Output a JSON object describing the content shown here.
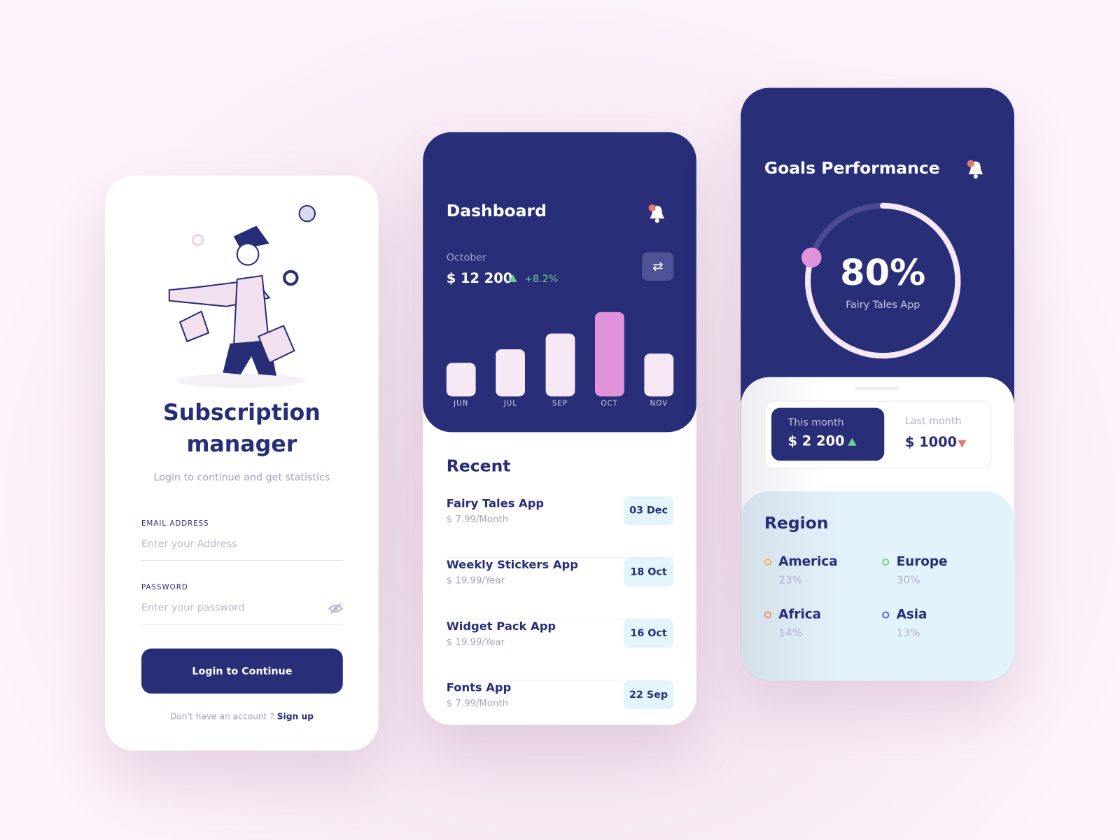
{
  "login": {
    "title_line1": "Subscription",
    "title_line2": "manager",
    "subtitle": "Login to continue and get statistics",
    "email_label": "EMAIL ADDRESS",
    "email_placeholder": "Enter your Address",
    "password_label": "PASSWORD",
    "password_placeholder": "Enter your password",
    "login_button": "Login to Continue",
    "signup_prompt": "Don't have an account ?",
    "signup_link": "Sign up",
    "illustration": "mailman-illustration"
  },
  "dashboard": {
    "title": "Dashboard",
    "month": "October",
    "amount": "$ 12 200",
    "change": "+8.2%",
    "icons": {
      "bell": "bell-icon",
      "swap": "swap-arrows-icon",
      "trend": "triangle-up-icon"
    },
    "recent_title": "Recent",
    "recent": [
      {
        "name": "Fairy Tales App",
        "price": "$ 7.99/Month",
        "date": "03 Dec"
      },
      {
        "name": "Weekly Stickers App",
        "price": "$ 19.99/Year",
        "date": "18 Oct"
      },
      {
        "name": "Widget Pack App",
        "price": "$ 19.99/Year",
        "date": "16 Oct"
      },
      {
        "name": "Fonts App",
        "price": "$ 7.99/Month",
        "date": "22 Sep"
      }
    ]
  },
  "chart_data": {
    "type": "bar",
    "categories": [
      "JUN",
      "JUL",
      "SEP",
      "OCT",
      "NOV"
    ],
    "values": [
      47,
      66,
      88,
      118,
      60
    ],
    "highlighted": "OCT",
    "colors": {
      "default": "#f6e8f5",
      "highlight": "#e092da"
    },
    "grid": false
  },
  "goals": {
    "title": "Goals Performance",
    "percent": "80%",
    "percent_value": 80,
    "app": "Fairy Tales App",
    "this_month_label": "This month",
    "this_month_value": "$ 2 200",
    "last_month_label": "Last month",
    "last_month_value": "$ 1000",
    "region_title": "Region",
    "regions": [
      {
        "name": "America",
        "pct": "23%",
        "color": "#f3b25f"
      },
      {
        "name": "Europe",
        "pct": "30%",
        "color": "#74d08b"
      },
      {
        "name": "Africa",
        "pct": "14%",
        "color": "#f08a6a"
      },
      {
        "name": "Asia",
        "pct": "13%",
        "color": "#5b5fe0"
      }
    ]
  },
  "colors": {
    "navy": "#282e78",
    "pink": "#e092da",
    "green": "#6fcf8c",
    "red": "#e07a7a",
    "bell_dot": "#e07a6a"
  }
}
